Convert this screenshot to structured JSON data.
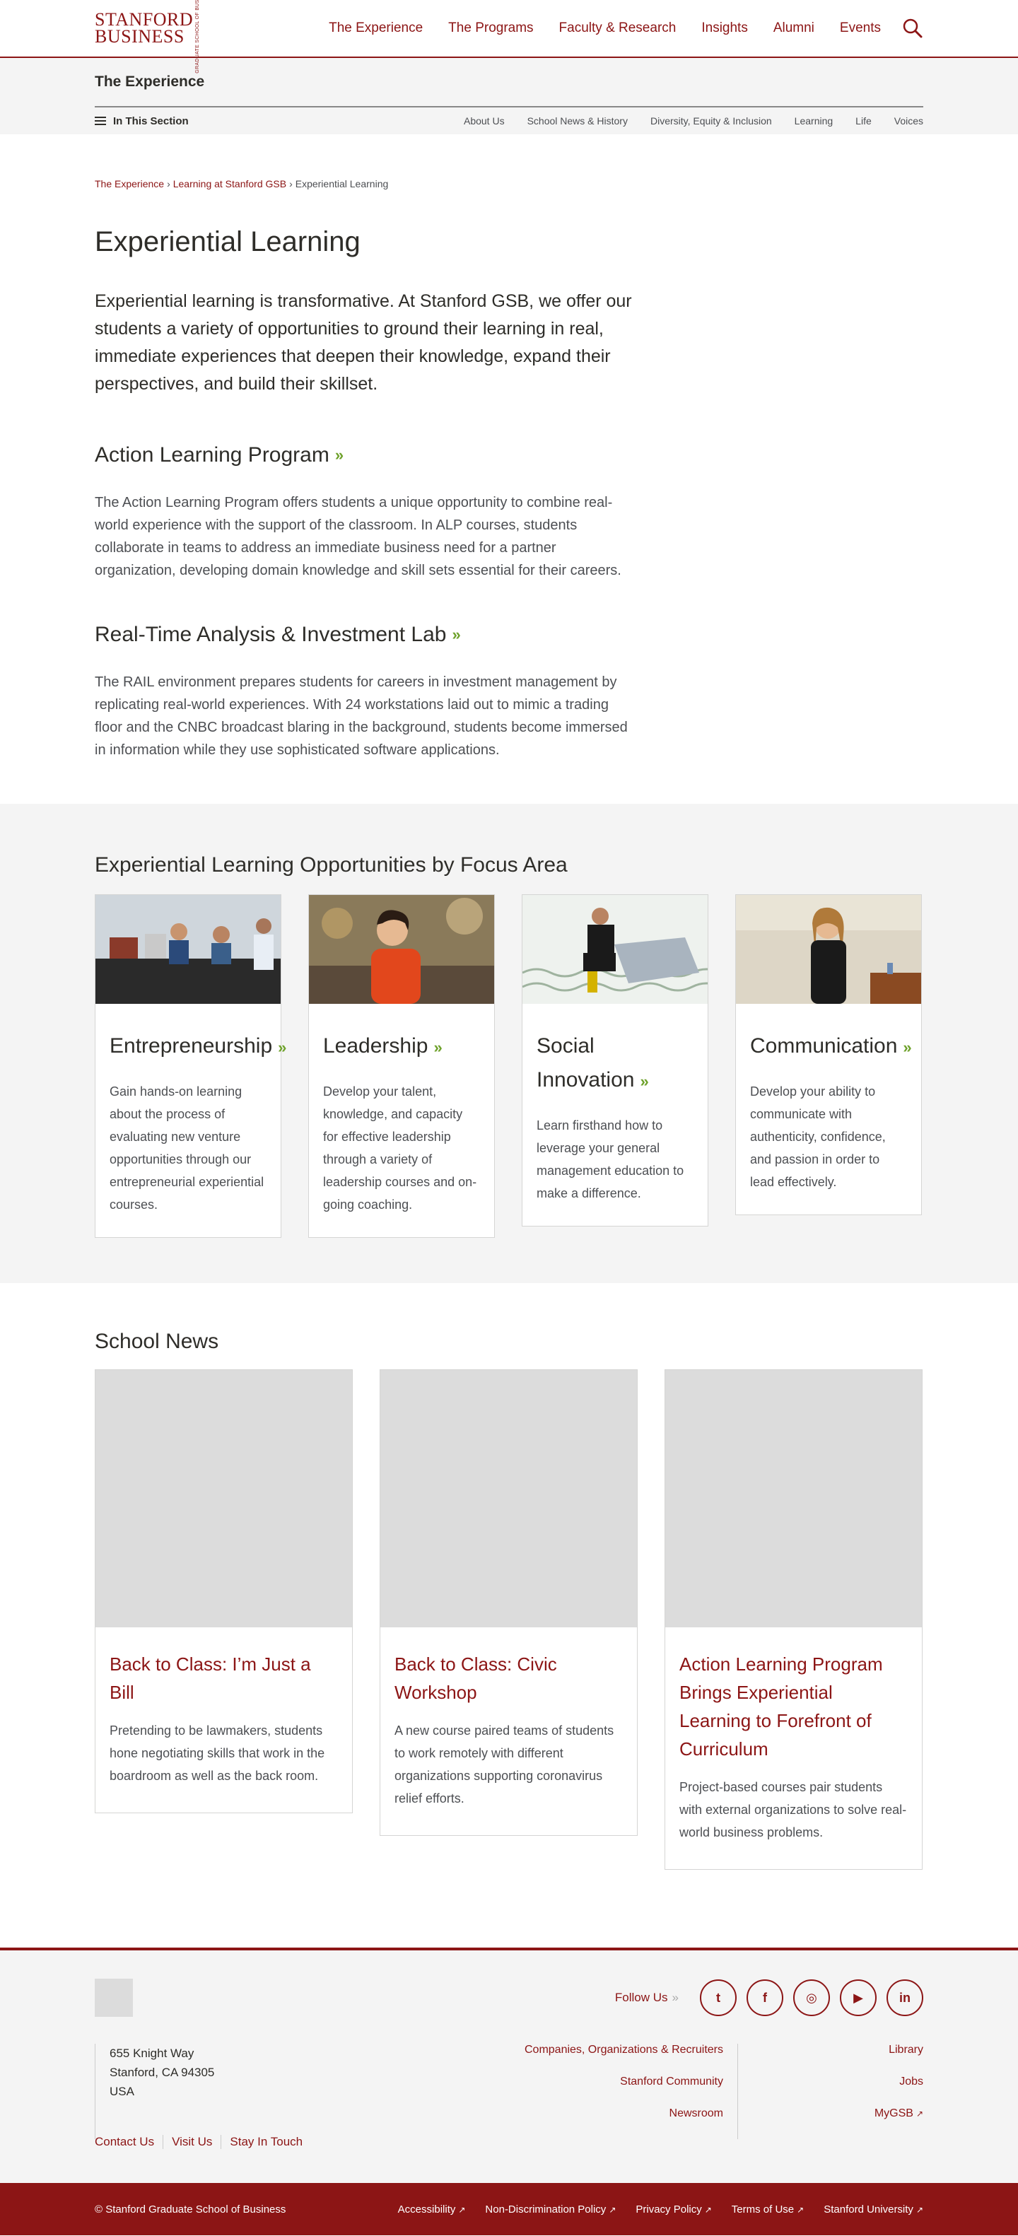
{
  "header": {
    "logo_main": "STANFORD",
    "logo_second": "BUSINESS",
    "logo_sub": "GRADUATE SCHOOL OF BUSINESS",
    "nav": [
      "The Experience",
      "The Programs",
      "Faculty & Research",
      "Insights",
      "Alumni",
      "Events"
    ],
    "search_icon": "search-icon"
  },
  "section": {
    "title": "The Experience",
    "in_this_section": "In This Section",
    "subnav": [
      "About Us",
      "School News & History",
      "Diversity, Equity & Inclusion",
      "Learning",
      "Life",
      "Voices"
    ]
  },
  "breadcrumb": {
    "items": [
      "The Experience",
      "Learning at Stanford GSB"
    ],
    "separator": "›",
    "current": "Experiential Learning"
  },
  "main": {
    "title": "Experiential Learning",
    "lead": "Experiential learning is transformative. At Stanford GSB, we offer our students a variety of opportunities to ground their learning in real, immediate experiences that deepen their knowledge, expand their perspectives, and build their skillset.",
    "blocks": [
      {
        "title": "Action Learning Program",
        "text": "The Action Learning Program offers students a unique opportunity to combine real-world experience with the support of the classroom. In ALP courses, students collaborate in teams to address an immediate business need for a partner organization, developing domain knowledge and skill sets essential for their careers."
      },
      {
        "title": "Real-Time Analysis & Investment Lab",
        "text": "The RAIL environment prepares students for careers in investment management by replicating real-world experiences. With 24 workstations laid out to mimic a trading floor and the CNBC broadcast blaring in the background, students become immersed in information while they use sophisticated software applications."
      }
    ],
    "chevron": "»"
  },
  "focus": {
    "title": "Experiential Learning Opportunities by Focus Area",
    "cards": [
      {
        "title": "Entrepreneurship",
        "text": "Gain hands-on learning about the process of evaluating new venture opportunities through our entrepreneurial experiential courses."
      },
      {
        "title": "Leadership",
        "text": "Develop your talent, knowledge, and capacity for effective leadership through a variety of leadership courses and on-going coaching."
      },
      {
        "title": "Social Innovation",
        "text": "Learn firsthand how to leverage your general management education to make a difference."
      },
      {
        "title": "Communication",
        "text": "Develop your ability to communicate with authenticity, confidence, and passion in order to lead effectively."
      }
    ]
  },
  "news": {
    "title": "School News",
    "items": [
      {
        "title": "Back to Class: I’m Just a Bill",
        "text": "Pretending to be lawmakers, students hone negotiating skills that work in the boardroom as well as the back room."
      },
      {
        "title": "Back to Class: Civic Workshop",
        "text": "A new course paired teams of students to work remotely with different organizations supporting coronavirus relief efforts."
      },
      {
        "title": "Action Learning Program Brings Experiential Learning to Forefront of Curriculum",
        "text": "Project-based courses pair students with external organizations to solve real-world business problems."
      }
    ]
  },
  "footer": {
    "follow_label": "Follow Us",
    "follow_chevron": "»",
    "social": [
      {
        "icon": "twitter-icon",
        "glyph": "t"
      },
      {
        "icon": "facebook-icon",
        "glyph": "f"
      },
      {
        "icon": "instagram-icon",
        "glyph": "◎"
      },
      {
        "icon": "youtube-icon",
        "glyph": "▶"
      },
      {
        "icon": "linkedin-icon",
        "glyph": "in"
      }
    ],
    "address": [
      "655 Knight Way",
      "Stanford, CA 94305",
      "USA"
    ],
    "links_a": [
      "Companies, Organizations & Recruiters",
      "Stanford Community",
      "Newsroom"
    ],
    "links_b": [
      "Library",
      "Jobs",
      "MyGSB"
    ],
    "contact": [
      "Contact Us",
      "Visit Us",
      "Stay In Touch"
    ],
    "copyright": "© Stanford Graduate School of Business",
    "legal": [
      "Accessibility",
      "Non-Discrimination Policy",
      "Privacy Policy",
      "Terms of Use",
      "Stanford University"
    ],
    "ext_icon": "↗"
  },
  "colors": {
    "brand": "#8c1515",
    "accent": "#6fa22c",
    "band": "#f4f4f4"
  }
}
